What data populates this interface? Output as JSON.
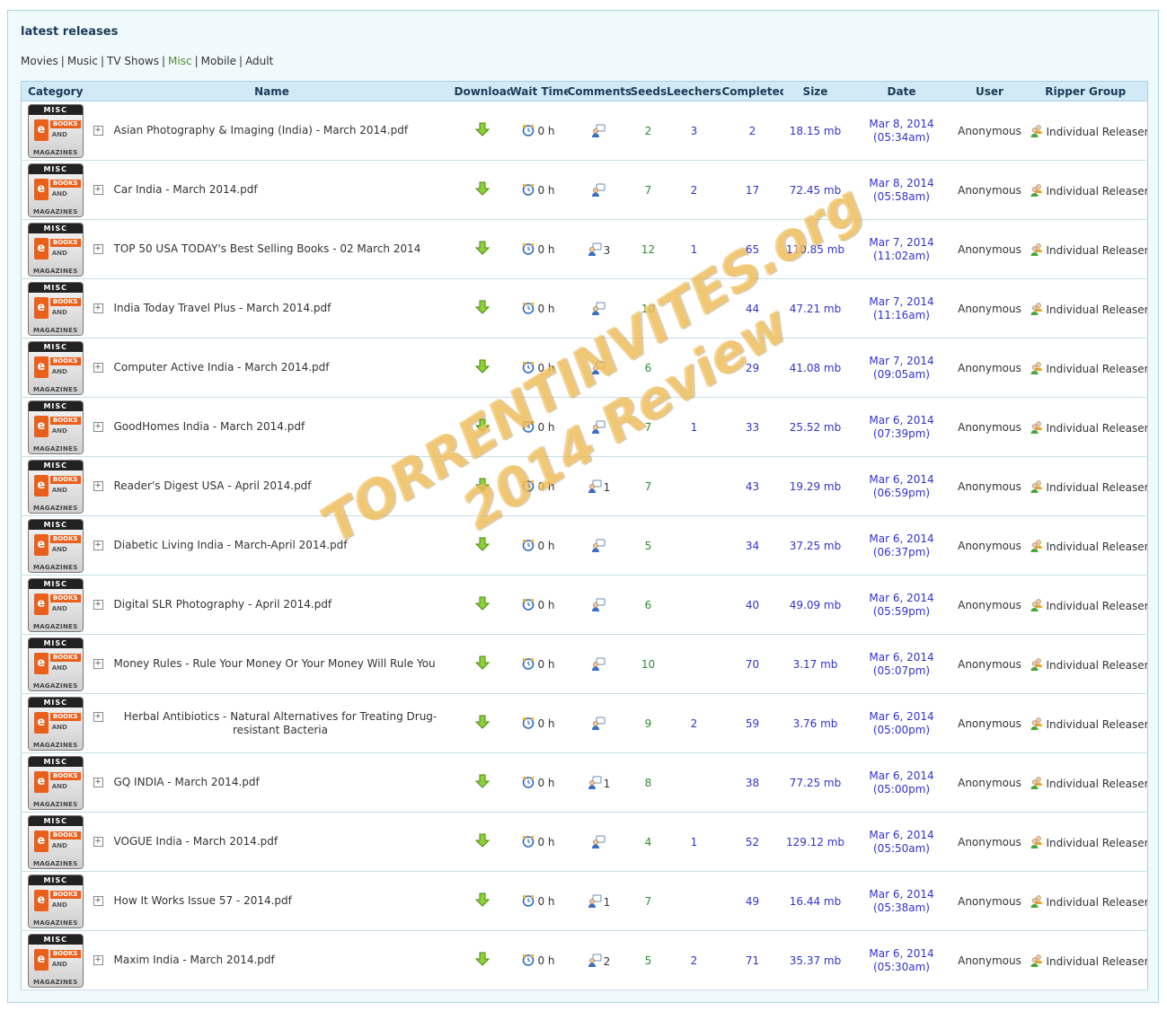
{
  "section_title": "latest releases",
  "categories": [
    {
      "label": "Movies",
      "active": false
    },
    {
      "label": "Music",
      "active": false
    },
    {
      "label": "TV Shows",
      "active": false
    },
    {
      "label": "Misc",
      "active": true
    },
    {
      "label": "Mobile",
      "active": false
    },
    {
      "label": "Adult",
      "active": false
    }
  ],
  "columns": [
    "Category",
    "Name",
    "Download",
    "Wait Time",
    "Comments",
    "Seeds",
    "Leechers",
    "Completed",
    "Size",
    "Date",
    "User",
    "Ripper Group"
  ],
  "category_badge": {
    "top": "MISC",
    "e": "e",
    "books": "BOOKS",
    "and": "AND",
    "magazines": "MAGAZINES"
  },
  "rows": [
    {
      "name": "Asian Photography & Imaging (India) - March 2014.pdf",
      "wait": "0 h",
      "comments": "",
      "seeds": "2",
      "leechers": "3",
      "completed": "2",
      "size": "18.15 mb",
      "date": "Mar 8, 2014",
      "time": "(05:34am)",
      "user": "Anonymous",
      "ripper": "Individual Releaser"
    },
    {
      "name": "Car India - March 2014.pdf",
      "wait": "0 h",
      "comments": "",
      "seeds": "7",
      "leechers": "2",
      "completed": "17",
      "size": "72.45 mb",
      "date": "Mar 8, 2014",
      "time": "(05:58am)",
      "user": "Anonymous",
      "ripper": "Individual Releaser"
    },
    {
      "name": "TOP 50 USA TODAY's Best Selling Books - 02 March 2014",
      "wait": "0 h",
      "comments": "3",
      "seeds": "12",
      "leechers": "1",
      "completed": "65",
      "size": "110.85 mb",
      "date": "Mar 7, 2014",
      "time": "(11:02am)",
      "user": "Anonymous",
      "ripper": "Individual Releaser"
    },
    {
      "name": "India Today Travel Plus - March 2014.pdf",
      "wait": "0 h",
      "comments": "",
      "seeds": "10",
      "leechers": "",
      "completed": "44",
      "size": "47.21 mb",
      "date": "Mar 7, 2014",
      "time": "(11:16am)",
      "user": "Anonymous",
      "ripper": "Individual Releaser"
    },
    {
      "name": "Computer Active India - March 2014.pdf",
      "wait": "0 h",
      "comments": "",
      "seeds": "6",
      "leechers": "",
      "completed": "29",
      "size": "41.08 mb",
      "date": "Mar 7, 2014",
      "time": "(09:05am)",
      "user": "Anonymous",
      "ripper": "Individual Releaser"
    },
    {
      "name": "GoodHomes India - March 2014.pdf",
      "wait": "0 h",
      "comments": "",
      "seeds": "7",
      "leechers": "1",
      "completed": "33",
      "size": "25.52 mb",
      "date": "Mar 6, 2014",
      "time": "(07:39pm)",
      "user": "Anonymous",
      "ripper": "Individual Releaser"
    },
    {
      "name": "Reader's Digest USA - April 2014.pdf",
      "wait": "0 h",
      "comments": "1",
      "seeds": "7",
      "leechers": "",
      "completed": "43",
      "size": "19.29 mb",
      "date": "Mar 6, 2014",
      "time": "(06:59pm)",
      "user": "Anonymous",
      "ripper": "Individual Releaser"
    },
    {
      "name": "Diabetic Living India - March-April 2014.pdf",
      "wait": "0 h",
      "comments": "",
      "seeds": "5",
      "leechers": "",
      "completed": "34",
      "size": "37.25 mb",
      "date": "Mar 6, 2014",
      "time": "(06:37pm)",
      "user": "Anonymous",
      "ripper": "Individual Releaser"
    },
    {
      "name": "Digital SLR Photography - April 2014.pdf",
      "wait": "0 h",
      "comments": "",
      "seeds": "6",
      "leechers": "",
      "completed": "40",
      "size": "49.09 mb",
      "date": "Mar 6, 2014",
      "time": "(05:59pm)",
      "user": "Anonymous",
      "ripper": "Individual Releaser"
    },
    {
      "name": "Money Rules - Rule Your Money Or Your Money Will Rule You",
      "wait": "0 h",
      "comments": "",
      "seeds": "10",
      "leechers": "",
      "completed": "70",
      "size": "3.17 mb",
      "date": "Mar 6, 2014",
      "time": "(05:07pm)",
      "user": "Anonymous",
      "ripper": "Individual Releaser"
    },
    {
      "name": "Herbal Antibiotics - Natural Alternatives for Treating Drug-resistant Bacteria",
      "wait": "0 h",
      "comments": "",
      "seeds": "9",
      "leechers": "2",
      "completed": "59",
      "size": "3.76 mb",
      "date": "Mar 6, 2014",
      "time": "(05:00pm)",
      "user": "Anonymous",
      "ripper": "Individual Releaser"
    },
    {
      "name": "GQ INDIA - March 2014.pdf",
      "wait": "0 h",
      "comments": "1",
      "seeds": "8",
      "leechers": "",
      "completed": "38",
      "size": "77.25 mb",
      "date": "Mar 6, 2014",
      "time": "(05:00pm)",
      "user": "Anonymous",
      "ripper": "Individual Releaser"
    },
    {
      "name": "VOGUE India - March 2014.pdf",
      "wait": "0 h",
      "comments": "",
      "seeds": "4",
      "leechers": "1",
      "completed": "52",
      "size": "129.12 mb",
      "date": "Mar 6, 2014",
      "time": "(05:50am)",
      "user": "Anonymous",
      "ripper": "Individual Releaser"
    },
    {
      "name": "How It Works Issue 57 - 2014.pdf",
      "wait": "0 h",
      "comments": "1",
      "seeds": "7",
      "leechers": "",
      "completed": "49",
      "size": "16.44 mb",
      "date": "Mar 6, 2014",
      "time": "(05:38am)",
      "user": "Anonymous",
      "ripper": "Individual Releaser"
    },
    {
      "name": "Maxim India - March 2014.pdf",
      "wait": "0 h",
      "comments": "2",
      "seeds": "5",
      "leechers": "2",
      "completed": "71",
      "size": "35.37 mb",
      "date": "Mar 6, 2014",
      "time": "(05:30am)",
      "user": "Anonymous",
      "ripper": "Individual Releaser"
    }
  ],
  "watermark": {
    "line1": "TORRENTINVITES.org",
    "line2": "2014 Review"
  },
  "colors": {
    "header_bg": "#d2eaf5",
    "panel_bg": "#f0fafd",
    "seeds": "#2e8b2e",
    "link_blue": "#3333cc",
    "watermark": "#f7c65f"
  },
  "icons": {
    "download": "download-arrow-icon",
    "wait": "alarm-clock-icon",
    "comments": "comment-user-icon",
    "ripper": "user-group-icon",
    "expand": "plus-box-icon"
  }
}
